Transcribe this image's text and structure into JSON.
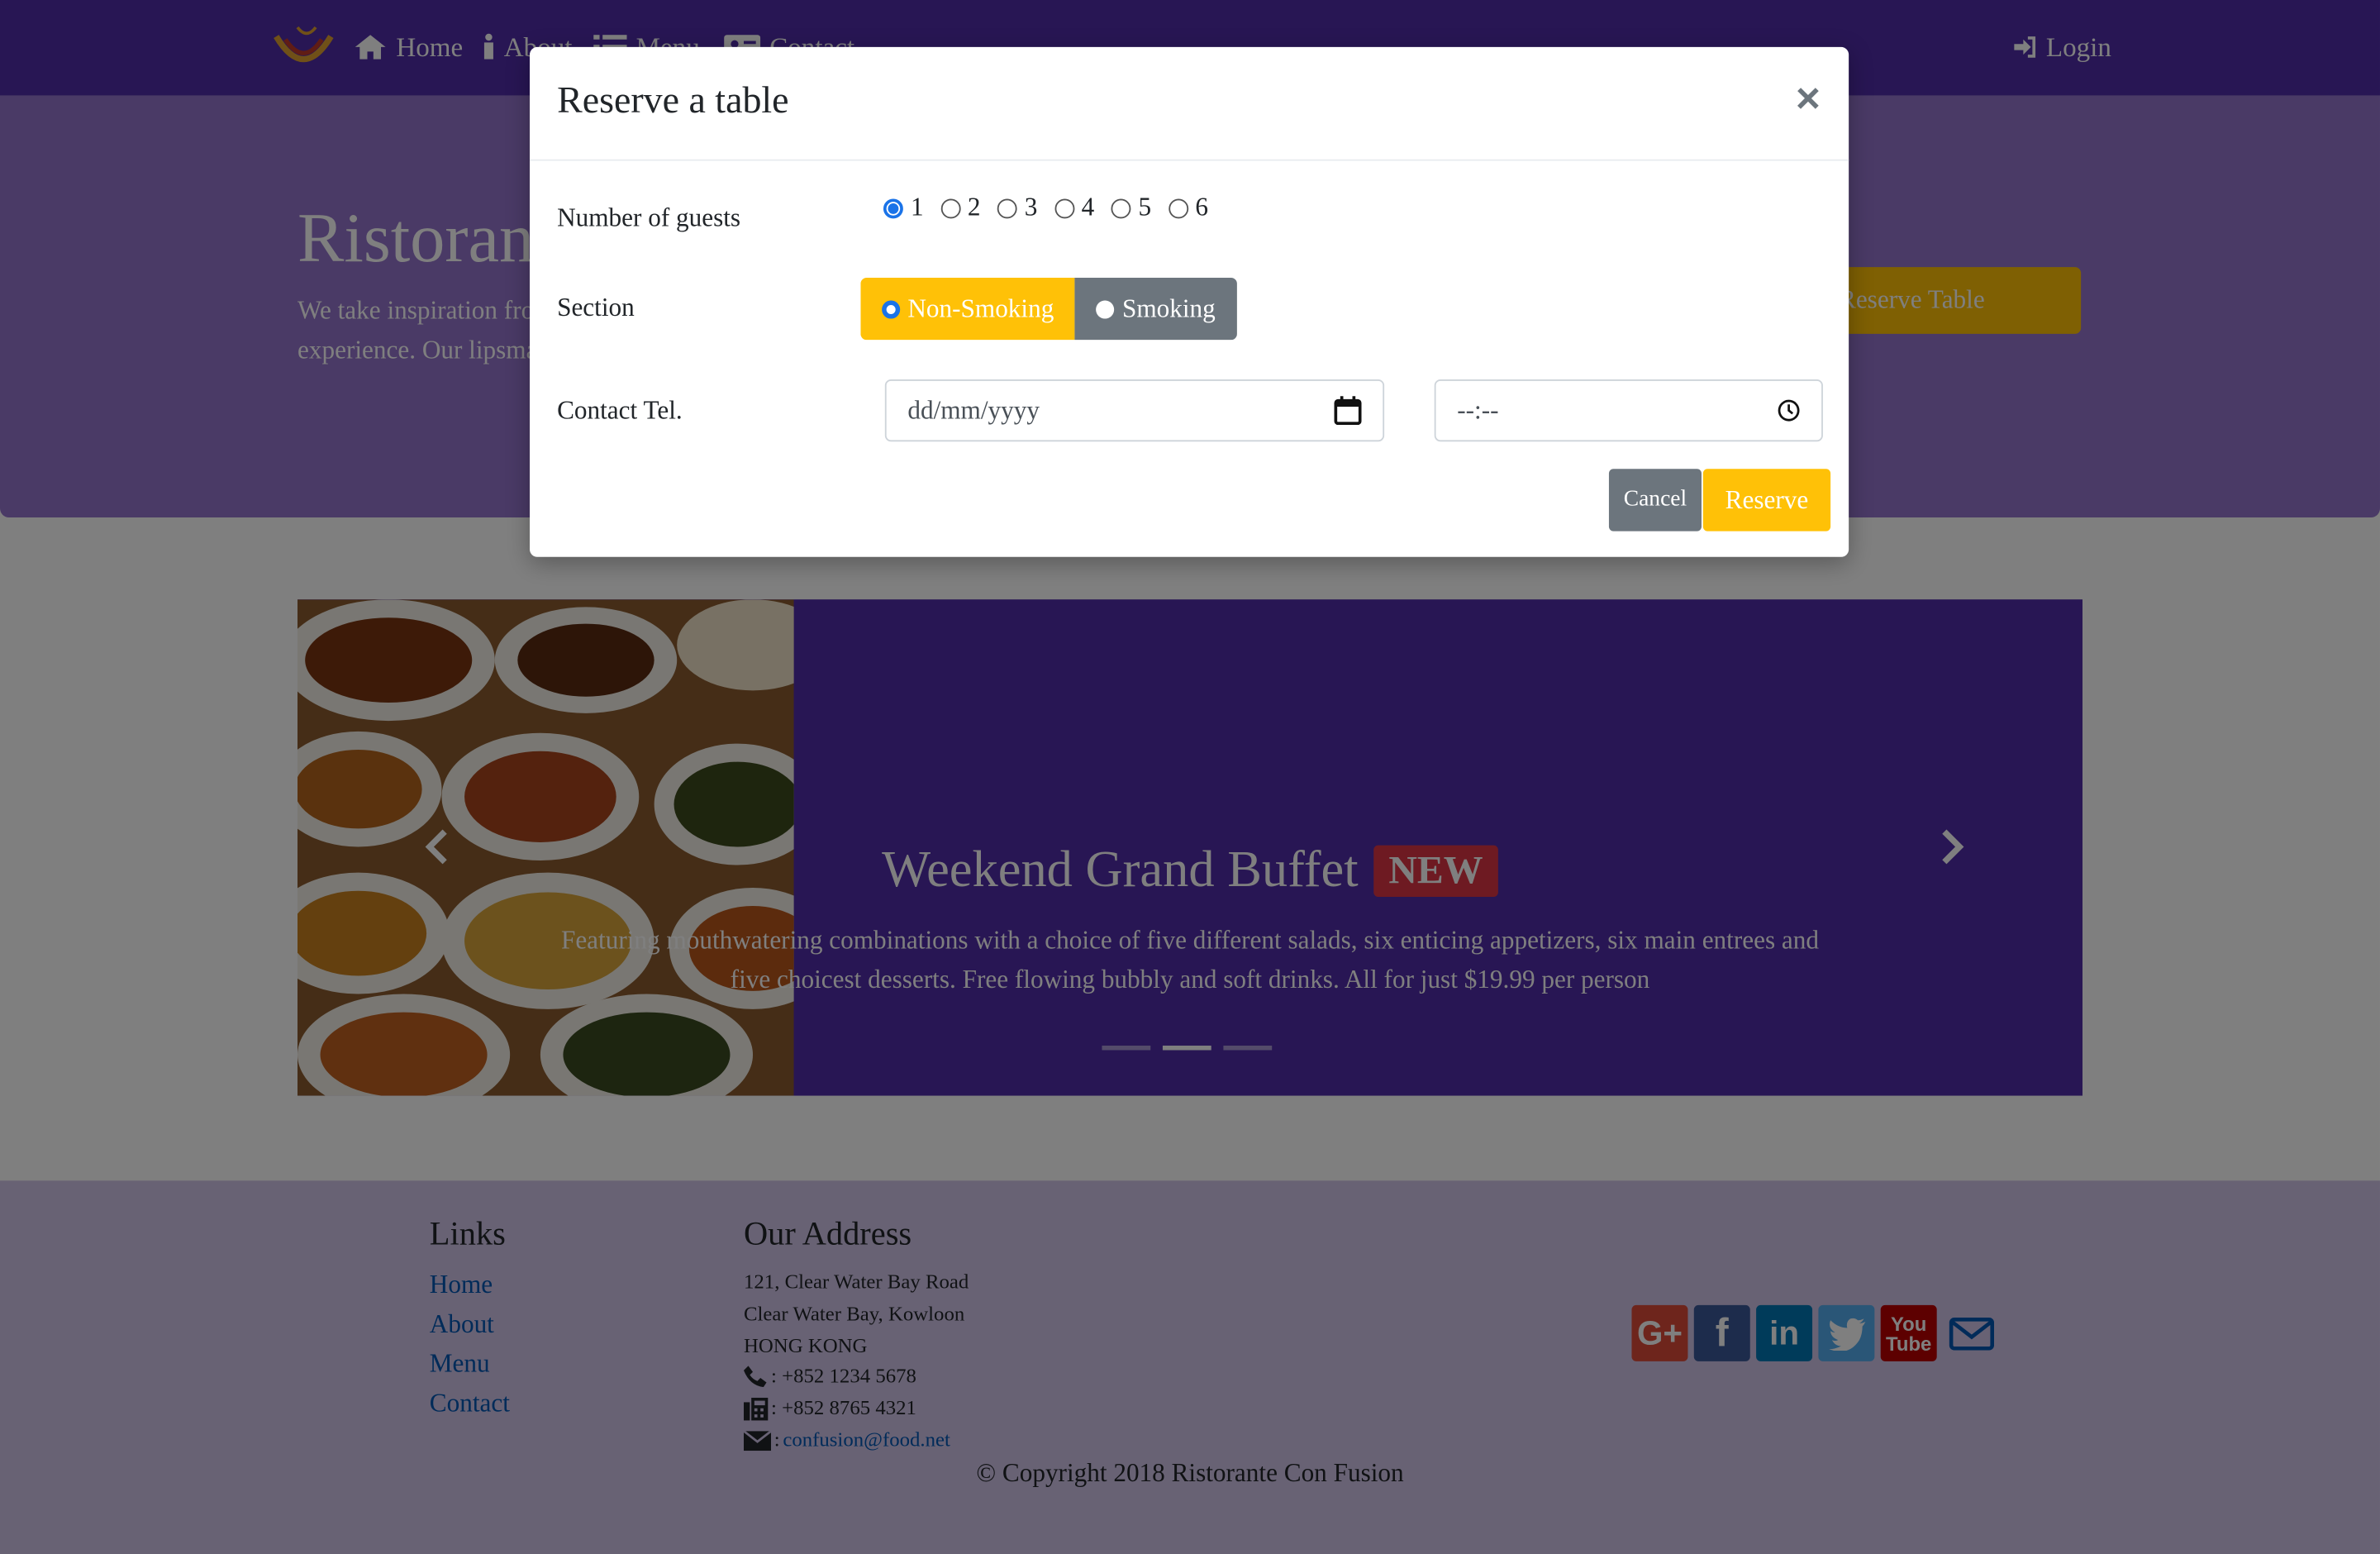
{
  "nav": {
    "items": [
      {
        "label": "Home",
        "icon": "home-icon"
      },
      {
        "label": "About",
        "icon": "info-icon"
      },
      {
        "label": "Menu",
        "icon": "list-icon"
      },
      {
        "label": "Contact",
        "icon": "address-card-icon"
      }
    ],
    "login": {
      "label": "Login",
      "icon": "sign-in-icon"
    }
  },
  "jumbotron": {
    "title": "Ristorante Con Fusion",
    "text": "We take inspiration from the World's best cuisines, and create a unique fusion experience. Our lipsmacking creations will tickle your culinary senses!",
    "button": "Reserve Table"
  },
  "carousel": {
    "title": "Weekend Grand Buffet",
    "badge": "NEW",
    "text": "Featuring mouthwatering combinations with a choice of five different salads, six enticing appetizers, six main entrees and five choicest desserts. Free flowing bubbly and soft drinks. All for just $19.99 per person",
    "active_slide": 2,
    "slide_count": 3
  },
  "footer": {
    "links_heading": "Links",
    "links": [
      "Home",
      "About",
      "Menu",
      "Contact"
    ],
    "address_heading": "Our Address",
    "address_lines": [
      "121, Clear Water Bay Road",
      "Clear Water Bay, Kowloon",
      "HONG KONG"
    ],
    "phone": ": +852 1234 5678",
    "fax": ": +852 8765 4321",
    "email_prefix": ": ",
    "email": "confusion@food.net",
    "socials": [
      "google-plus-icon",
      "facebook-icon",
      "linkedin-icon",
      "twitter-icon",
      "youtube-icon",
      "envelope-icon"
    ],
    "copyright": "© Copyright 2018 Ristorante Con Fusion"
  },
  "modal": {
    "title": "Reserve a table",
    "close": "×",
    "guests_label": "Number of guests",
    "guest_options": [
      "1",
      "2",
      "3",
      "4",
      "5",
      "6"
    ],
    "guests_selected": "1",
    "section_label": "Section",
    "section_options": [
      "Non-Smoking",
      "Smoking"
    ],
    "section_selected": "Non-Smoking",
    "contact_label": "Contact Tel.",
    "date_placeholder": "dd/mm/yyyy",
    "time_placeholder": "--:--",
    "cancel": "Cancel",
    "reserve": "Reserve"
  },
  "colors": {
    "primary": "#512da8",
    "light": "#9575cd",
    "footer": "#d1c4e9",
    "warning": "#ffc107",
    "secondary": "#6c757d",
    "danger": "#dc3545"
  }
}
